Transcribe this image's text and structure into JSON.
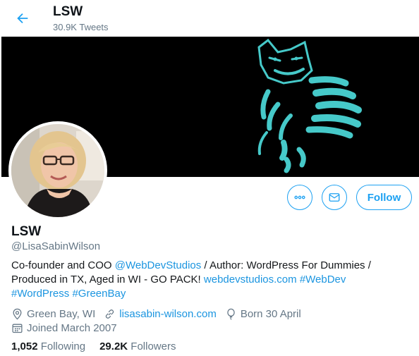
{
  "header": {
    "title": "LSW",
    "tweet_count": "30.9K Tweets"
  },
  "profile": {
    "name": "LSW",
    "handle": "@LisaSabinWilson",
    "bio": {
      "part1": "Co-founder and COO ",
      "mention": "@WebDevStudios",
      "part2": " / Author: WordPress For Dummies / Produced in TX, Aged in WI - GO PACK! ",
      "url": "webdevstudios.com",
      "hashtag1": "#WebDev",
      "hashtag2": "#WordPress",
      "hashtag3": "#GreenBay"
    },
    "location": "Green Bay, WI",
    "website": "lisasabin-wilson.com",
    "birthday": "Born 30 April",
    "joined": "Joined March 2007",
    "following_count": "1,052",
    "following_label": "Following",
    "followers_count": "29.2K",
    "followers_label": "Followers"
  },
  "actions": {
    "follow_label": "Follow"
  },
  "colors": {
    "accent": "#1da1f2",
    "link": "#1b95e0",
    "secondary_text": "#657786",
    "banner_art": "#46c9c9"
  },
  "icons": {
    "back": "arrow-left-icon",
    "more": "more-icon",
    "message": "mail-icon",
    "location": "map-pin-icon",
    "website": "link-icon",
    "birthday": "balloon-icon",
    "joined": "calendar-icon"
  }
}
